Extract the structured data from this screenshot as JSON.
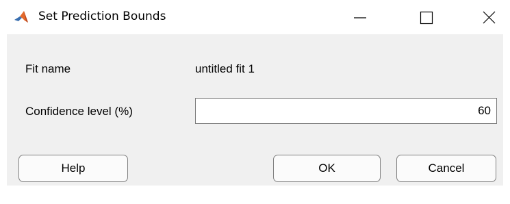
{
  "window": {
    "title": "Set Prediction Bounds",
    "controls": {
      "minimize": "minimize-icon",
      "maximize": "maximize-icon",
      "close": "close-icon"
    }
  },
  "form": {
    "fit_name_label": "Fit name",
    "fit_name_value": "untitled fit 1",
    "confidence_label": "Confidence level (%)",
    "confidence_value": "60"
  },
  "buttons": {
    "help": "Help",
    "ok": "OK",
    "cancel": "Cancel"
  },
  "colors": {
    "panel_bg": "#f0f0f0",
    "window_bg": "#ffffff",
    "field_border": "#7a7a7a",
    "button_bg": "#fbfbfb"
  }
}
